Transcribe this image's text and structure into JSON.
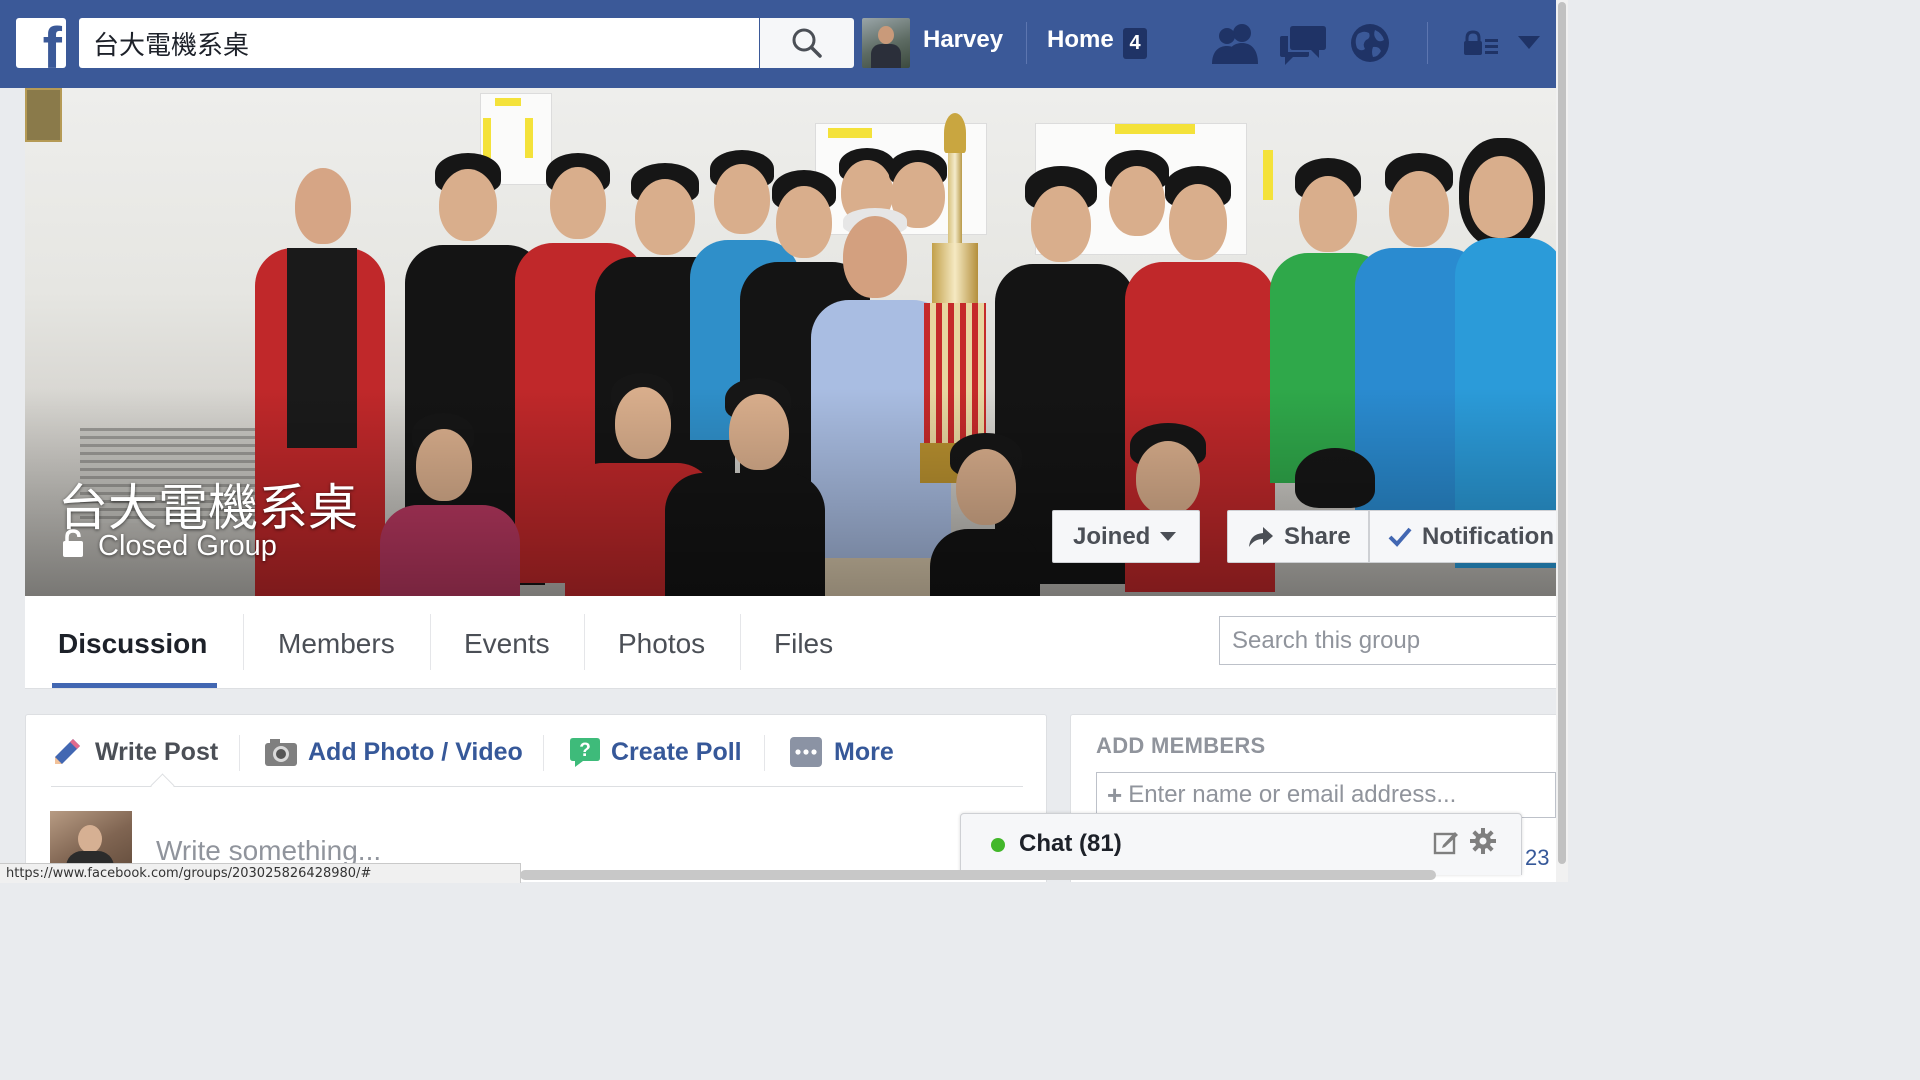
{
  "header": {
    "logo_letter": "f",
    "search_value": "台大電機系桌",
    "user_name": "Harvey",
    "home_label": "Home",
    "home_count": "4",
    "icons": [
      "friend-requests-icon",
      "messages-icon",
      "notifications-globe-icon",
      "privacy-shortcuts-icon",
      "account-menu-chevron-icon"
    ],
    "bar_color": "#3b5998"
  },
  "cover": {
    "group_name": "台大電機系桌",
    "privacy_label": "Closed Group",
    "joined_label": "Joined",
    "share_label": "Share",
    "notifications_label": "Notification"
  },
  "tabs": {
    "items": [
      {
        "label": "Discussion",
        "active": true
      },
      {
        "label": "Members"
      },
      {
        "label": "Events"
      },
      {
        "label": "Photos"
      },
      {
        "label": "Files"
      }
    ],
    "search_placeholder": "Search this group",
    "accent_color": "#4267b2"
  },
  "composer": {
    "write_post": "Write Post",
    "add_photo": "Add Photo / Video",
    "create_poll": "Create Poll",
    "more": "More",
    "placeholder": "Write something..."
  },
  "add_members": {
    "title": "ADD MEMBERS",
    "input_placeholder": "Enter name or email address..."
  },
  "chat": {
    "label": "Chat (81)",
    "corner_number": "23",
    "status_color": "#42b72a"
  },
  "status_bar": {
    "url": "https://www.facebook.com/groups/203025826428980/#"
  }
}
